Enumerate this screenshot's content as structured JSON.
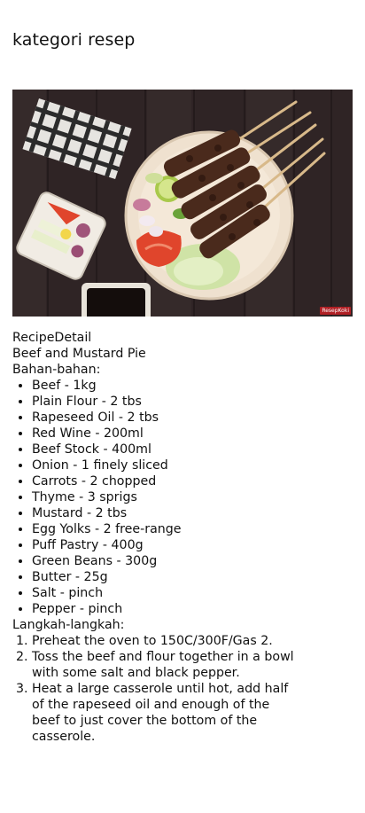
{
  "page": {
    "title": "kategori resep"
  },
  "recipe": {
    "section_label": "RecipeDetail",
    "name": "Beef and Mustard Pie",
    "ingredients_heading": "Bahan-bahan:",
    "ingredients": [
      "Beef - 1kg",
      "Plain Flour - 2 tbs",
      "Rapeseed Oil - 2 tbs",
      "Red Wine - 200ml",
      "Beef Stock - 400ml",
      "Onion - 1 finely sliced",
      "Carrots - 2 chopped",
      "Thyme - 3 sprigs",
      "Mustard - 2 tbs",
      "Egg Yolks - 2 free-range",
      "Puff Pastry - 400g",
      "Green Beans - 300g",
      "Butter - 25g",
      "Salt - pinch",
      "Pepper - pinch"
    ],
    "steps_heading": "Langkah-langkah:",
    "steps": [
      "Preheat the oven to 150C/300F/Gas 2.",
      "Toss the beef and flour together in a bowl with some salt and black pepper.",
      "Heat a large casserole until hot, add half of the rapeseed oil and enough of the beef to just cover the bottom of the casserole."
    ]
  },
  "image": {
    "watermark": "ResepKoki",
    "colors": {
      "wood": "#2f2425",
      "plate": "#efe1cf",
      "satay": "#4a2a1c",
      "tomato": "#e0452c",
      "cabbage": "#cfe3a6"
    }
  }
}
